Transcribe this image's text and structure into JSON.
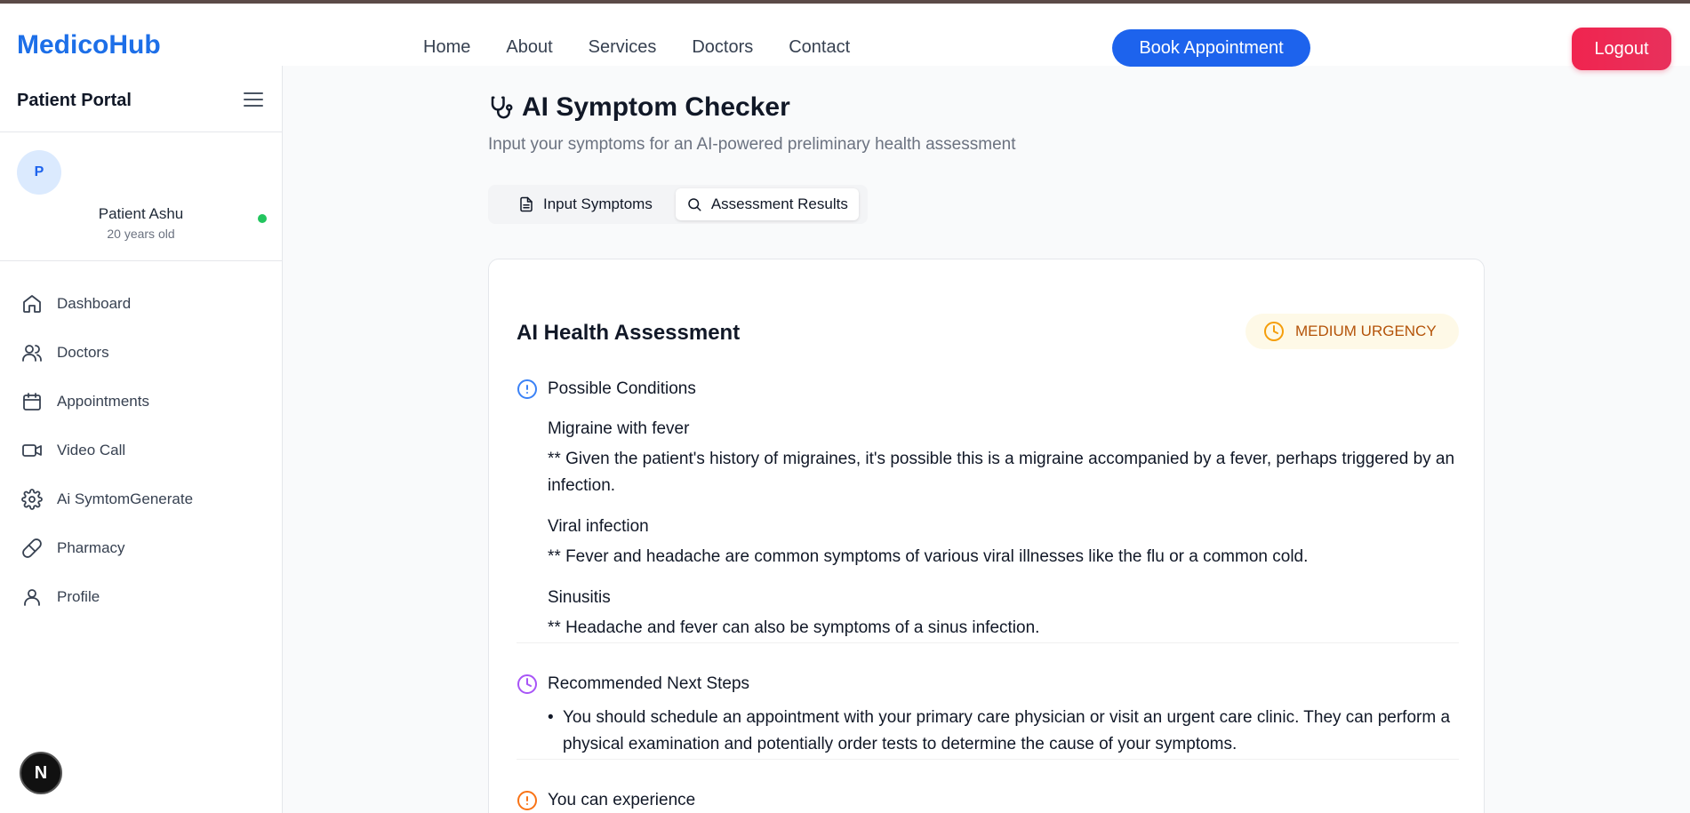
{
  "nav": {
    "brand": "MedicoHub",
    "links": [
      "Home",
      "About",
      "Services",
      "Doctors",
      "Contact"
    ],
    "book_label": "Book Appointment",
    "logout_label": "Logout"
  },
  "sidebar": {
    "title": "Patient Portal",
    "patient": {
      "initial": "P",
      "name": "Patient Ashu",
      "age": "20 years old",
      "status_color": "#22c55e"
    },
    "items": [
      {
        "label": "Dashboard",
        "icon": "home-icon"
      },
      {
        "label": "Doctors",
        "icon": "users-icon"
      },
      {
        "label": "Appointments",
        "icon": "calendar-icon"
      },
      {
        "label": "Video Call",
        "icon": "video-icon"
      },
      {
        "label": "Ai SymtomGenerate",
        "icon": "gear-icon"
      },
      {
        "label": "Pharmacy",
        "icon": "pill-icon"
      },
      {
        "label": "Profile",
        "icon": "user-icon"
      }
    ],
    "badge": "N"
  },
  "main": {
    "title": "AI Symptom Checker",
    "subtitle": "Input your symptoms for an AI-powered preliminary health assessment",
    "tabs": [
      {
        "label": "Input Symptoms",
        "icon": "document-icon",
        "active": false
      },
      {
        "label": "Assessment Results",
        "icon": "search-icon",
        "active": true
      }
    ]
  },
  "assessment": {
    "title": "AI Health Assessment",
    "urgency": "MEDIUM URGENCY",
    "conditions_heading": "Possible Conditions",
    "conditions": [
      {
        "name": "Migraine with fever",
        "description": "** Given the patient's history of migraines, it's possible this is a migraine accompanied by a fever, perhaps triggered by an infection."
      },
      {
        "name": "Viral infection",
        "description": "** Fever and headache are common symptoms of various viral illnesses like the flu or a common cold."
      },
      {
        "name": "Sinusitis",
        "description": "** Headache and fever can also be symptoms of a sinus infection."
      }
    ],
    "next_steps_heading": "Recommended Next Steps",
    "next_steps": [
      "You should schedule an appointment with your primary care physician or visit an urgent care clinic. They can perform a physical examination and potentially order tests to determine the cause of your symptoms."
    ],
    "experience_heading": "You can experience"
  },
  "colors": {
    "brand": "#1d6fe8",
    "primary_button": "#1d63ed",
    "logout": "#f0244f",
    "urgency_text": "#b45309",
    "urgency_bg": "#fef9e7",
    "conditions_icon": "#3b82f6",
    "next_steps_icon": "#a855f7",
    "experience_icon": "#f97316"
  }
}
